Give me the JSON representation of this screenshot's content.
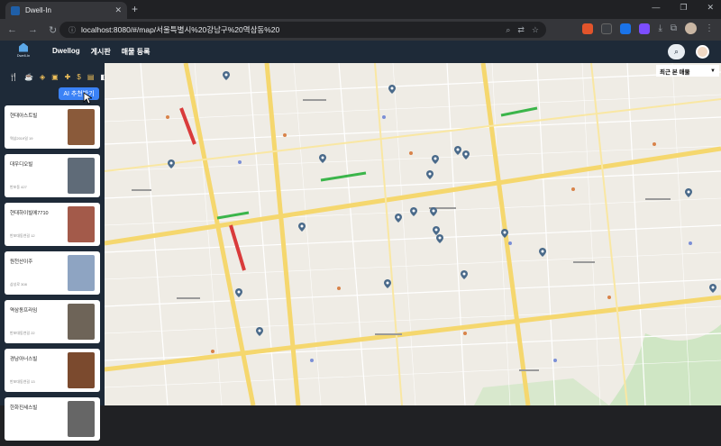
{
  "browser": {
    "tab_title": "Dwell-In",
    "tab_close": "✕",
    "new_tab": "+",
    "url": "localhost:8080/#/map/서울특별시%20강남구%20역삼동%20",
    "window_controls": [
      "—",
      "❐",
      "✕"
    ]
  },
  "app": {
    "logo_text": "Dwell-In",
    "menu": [
      "Dwellog",
      "게시판",
      "매물 등록"
    ],
    "search_icon": "search-icon",
    "avatar": "avatar"
  },
  "sidebar": {
    "category_icons": [
      "restaurant-icon",
      "cafe-icon",
      "layers-icon",
      "bank-icon",
      "hospital-icon",
      "dollar-icon",
      "document-icon",
      "half-circle-icon"
    ],
    "category_glyphs": [
      "🍴",
      "☕",
      "◈",
      "▣",
      "✚",
      "$",
      "▤",
      "◧"
    ],
    "ai_button": "AI 추천받기",
    "listings": [
      {
        "name": "현대아스트빌",
        "sub": "역삼2019일 19",
        "thumb_color": "#8a5a3a"
      },
      {
        "name": "대우디오빌",
        "sub": "반포동 427",
        "thumb_color": "#5f6b78"
      },
      {
        "name": "현대하이빌에7710",
        "sub": "반포대동연길 12",
        "thumb_color": "#a35a4a"
      },
      {
        "name": "원천산이주",
        "sub": "삼성로 308",
        "thumb_color": "#8ea4c2"
      },
      {
        "name": "역삼동프라임",
        "sub": "반포대동연길 22",
        "thumb_color": "#6e6458"
      },
      {
        "name": "경남아너스빌",
        "sub": "반포대동연길 13",
        "thumb_color": "#7b4a2e"
      },
      {
        "name": "한화진세스빌",
        "sub": "",
        "thumb_color": "#666666"
      }
    ]
  },
  "map": {
    "recent_dropdown": "최근 본 매물",
    "pins": 30
  }
}
